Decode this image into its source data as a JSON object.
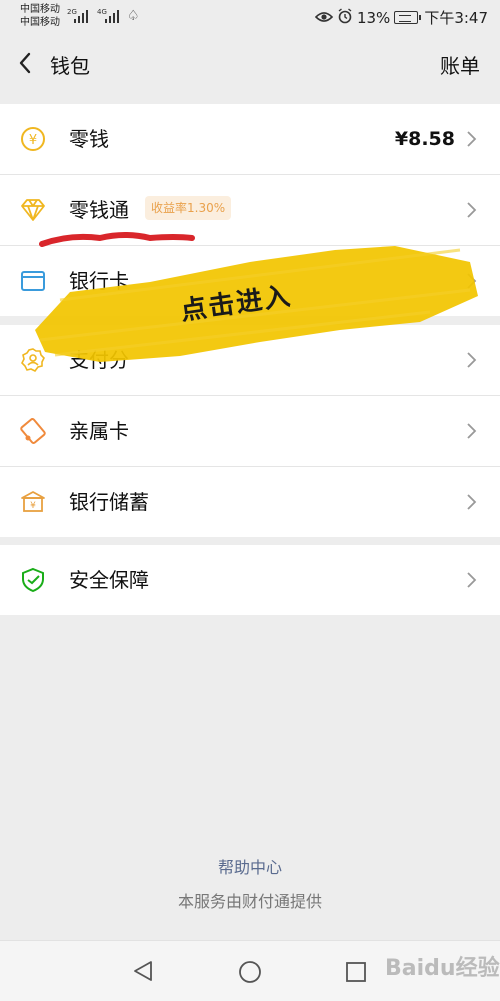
{
  "status": {
    "carrier1": "中国移动",
    "carrier2": "中国移动",
    "net1": "2G",
    "net2": "4G",
    "battery": "13%",
    "time": "下午3:47"
  },
  "nav": {
    "title": "钱包",
    "bill": "账单"
  },
  "groups": [
    {
      "items": [
        {
          "label": "零钱",
          "value": "¥8.58",
          "icon": "yuan-coin-icon"
        },
        {
          "label": "零钱通",
          "badge": "收益率1.30%",
          "icon": "diamond-icon"
        },
        {
          "label": "银行卡",
          "icon": "bank-card-icon"
        }
      ]
    },
    {
      "items": [
        {
          "label": "支付分",
          "icon": "badge-person-icon"
        },
        {
          "label": "亲属卡",
          "icon": "family-card-icon"
        },
        {
          "label": "银行储蓄",
          "icon": "bank-savings-icon"
        }
      ]
    },
    {
      "items": [
        {
          "label": "安全保障",
          "icon": "shield-check-icon"
        }
      ]
    }
  ],
  "footer": {
    "help": "帮助中心",
    "note": "本服务由财付通提供"
  },
  "annotation": {
    "text": "点击进入"
  },
  "watermark": "Baidu经验",
  "colors": {
    "icon_yellow": "#f0b721",
    "icon_blue": "#3a9bdc",
    "icon_orange": "#f08a3c",
    "icon_green": "#1aad19",
    "annotation_red": "#d9262b",
    "annotation_yellow": "#f2c500"
  }
}
